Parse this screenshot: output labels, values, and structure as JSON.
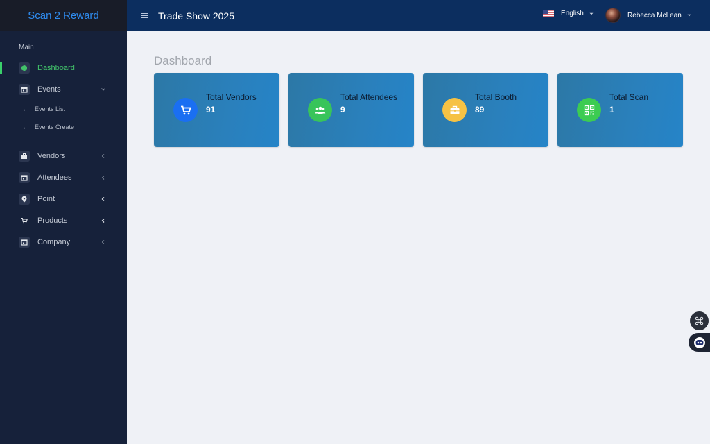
{
  "app": {
    "brand": "Scan 2 Reward"
  },
  "topbar": {
    "title": "Trade Show 2025",
    "language": "English",
    "user_name": "Rebecca McLean"
  },
  "sidebar": {
    "section_label": "Main",
    "items": [
      {
        "label": "Dashboard",
        "icon": "cube-icon",
        "active": true
      },
      {
        "label": "Events",
        "icon": "calendar-icon",
        "expanded": true
      },
      {
        "label": "Events List",
        "sub": true
      },
      {
        "label": "Events Create",
        "sub": true
      },
      {
        "label": "Vendors",
        "icon": "briefcase-icon"
      },
      {
        "label": "Attendees",
        "icon": "calendar-icon"
      },
      {
        "label": "Point",
        "icon": "map-pin-icon"
      },
      {
        "label": "Products",
        "icon": "cart-icon"
      },
      {
        "label": "Company",
        "icon": "calendar-icon"
      }
    ]
  },
  "main": {
    "page_title": "Dashboard",
    "cards": [
      {
        "label": "Total Vendors",
        "value": "91",
        "icon": "cart-icon",
        "color": "#1a6ff2"
      },
      {
        "label": "Total Attendees",
        "value": "9",
        "icon": "users-icon",
        "color": "#38c45a"
      },
      {
        "label": "Total Booth",
        "value": "89",
        "icon": "briefcase-icon",
        "color": "#f6c244"
      },
      {
        "label": "Total Scan",
        "value": "1",
        "icon": "qr-code-icon",
        "color": "#3ccc52"
      }
    ]
  },
  "colors": {
    "sidebar_bg": "#16213a",
    "topbar_bg": "#0c2e5f",
    "accent_green": "#42c36a",
    "brand_blue": "#2f8cf0"
  }
}
